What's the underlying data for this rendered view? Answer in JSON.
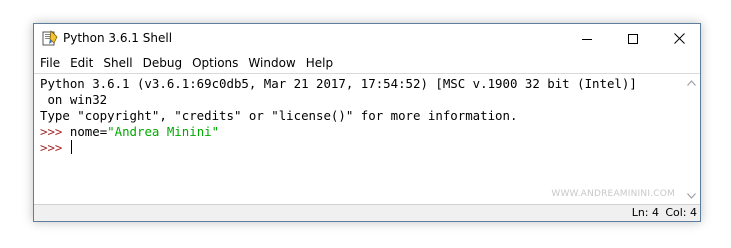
{
  "window": {
    "title": "Python 3.6.1 Shell",
    "app_icon": "python-idle-icon",
    "controls": {
      "minimize_icon": "minimize-icon",
      "maximize_icon": "maximize-icon",
      "close_icon": "close-icon"
    }
  },
  "menu": {
    "items": [
      "File",
      "Edit",
      "Shell",
      "Debug",
      "Options",
      "Window",
      "Help"
    ]
  },
  "shell": {
    "lines": [
      "Python 3.6.1 (v3.6.1:69c0db5, Mar 21 2017, 17:54:52) [MSC v.1900 32 bit (Intel)]",
      " on win32",
      "Type \"copyright\", \"credits\" or \"license()\" for more information."
    ],
    "prompt": ">>>",
    "input_code": "nome=",
    "input_string": "\"Andrea Minini\"",
    "watermark": "WWW.ANDREAMININI.COM"
  },
  "status": {
    "line": "Ln: 4",
    "col": "Col: 4"
  },
  "colors": {
    "prompt": "#a52a2a",
    "string": "#00aa00",
    "border": "#5f7d9c"
  }
}
